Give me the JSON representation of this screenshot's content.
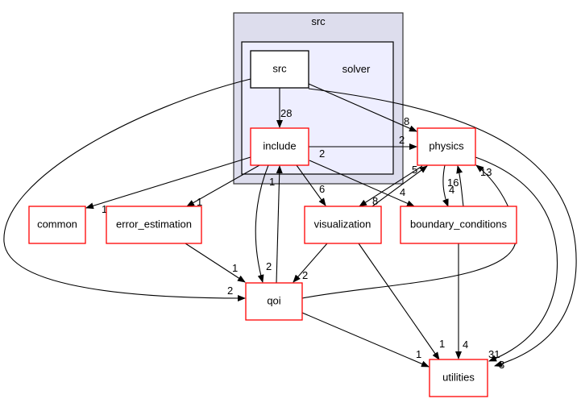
{
  "clusters": {
    "outer": "src",
    "inner": "solver"
  },
  "nodes": {
    "src": "src",
    "include": "include",
    "physics": "physics",
    "common": "common",
    "error_estimation": "error_estimation",
    "visualization": "visualization",
    "boundary_conditions": "boundary_conditions",
    "qoi": "qoi",
    "utilities": "utilities"
  },
  "edges": {
    "src_include": "28",
    "src_physics": "8",
    "src_utilities": "3",
    "src_qoi": "2",
    "include_physics": "2",
    "physics_include": "2",
    "include_common": "1",
    "include_error_estimation": "1",
    "include_visualization": "6",
    "include_boundary_conditions": "4",
    "include_qoi": "2",
    "qoi_include": "1",
    "physics_visualization": "5",
    "visualization_physics": "8",
    "physics_boundary_conditions": "4",
    "boundary_conditions_physics": "16",
    "qoi_physics": "13",
    "physics_utilities": "31",
    "error_estimation_qoi": "1",
    "visualization_qoi": "2",
    "visualization_utilities": "1",
    "boundary_conditions_utilities": "4",
    "qoi_utilities": "1"
  },
  "colors": {
    "outer_cluster": "#dddded",
    "inner_cluster": "#eeeeff",
    "node_border": "#ff0000"
  }
}
